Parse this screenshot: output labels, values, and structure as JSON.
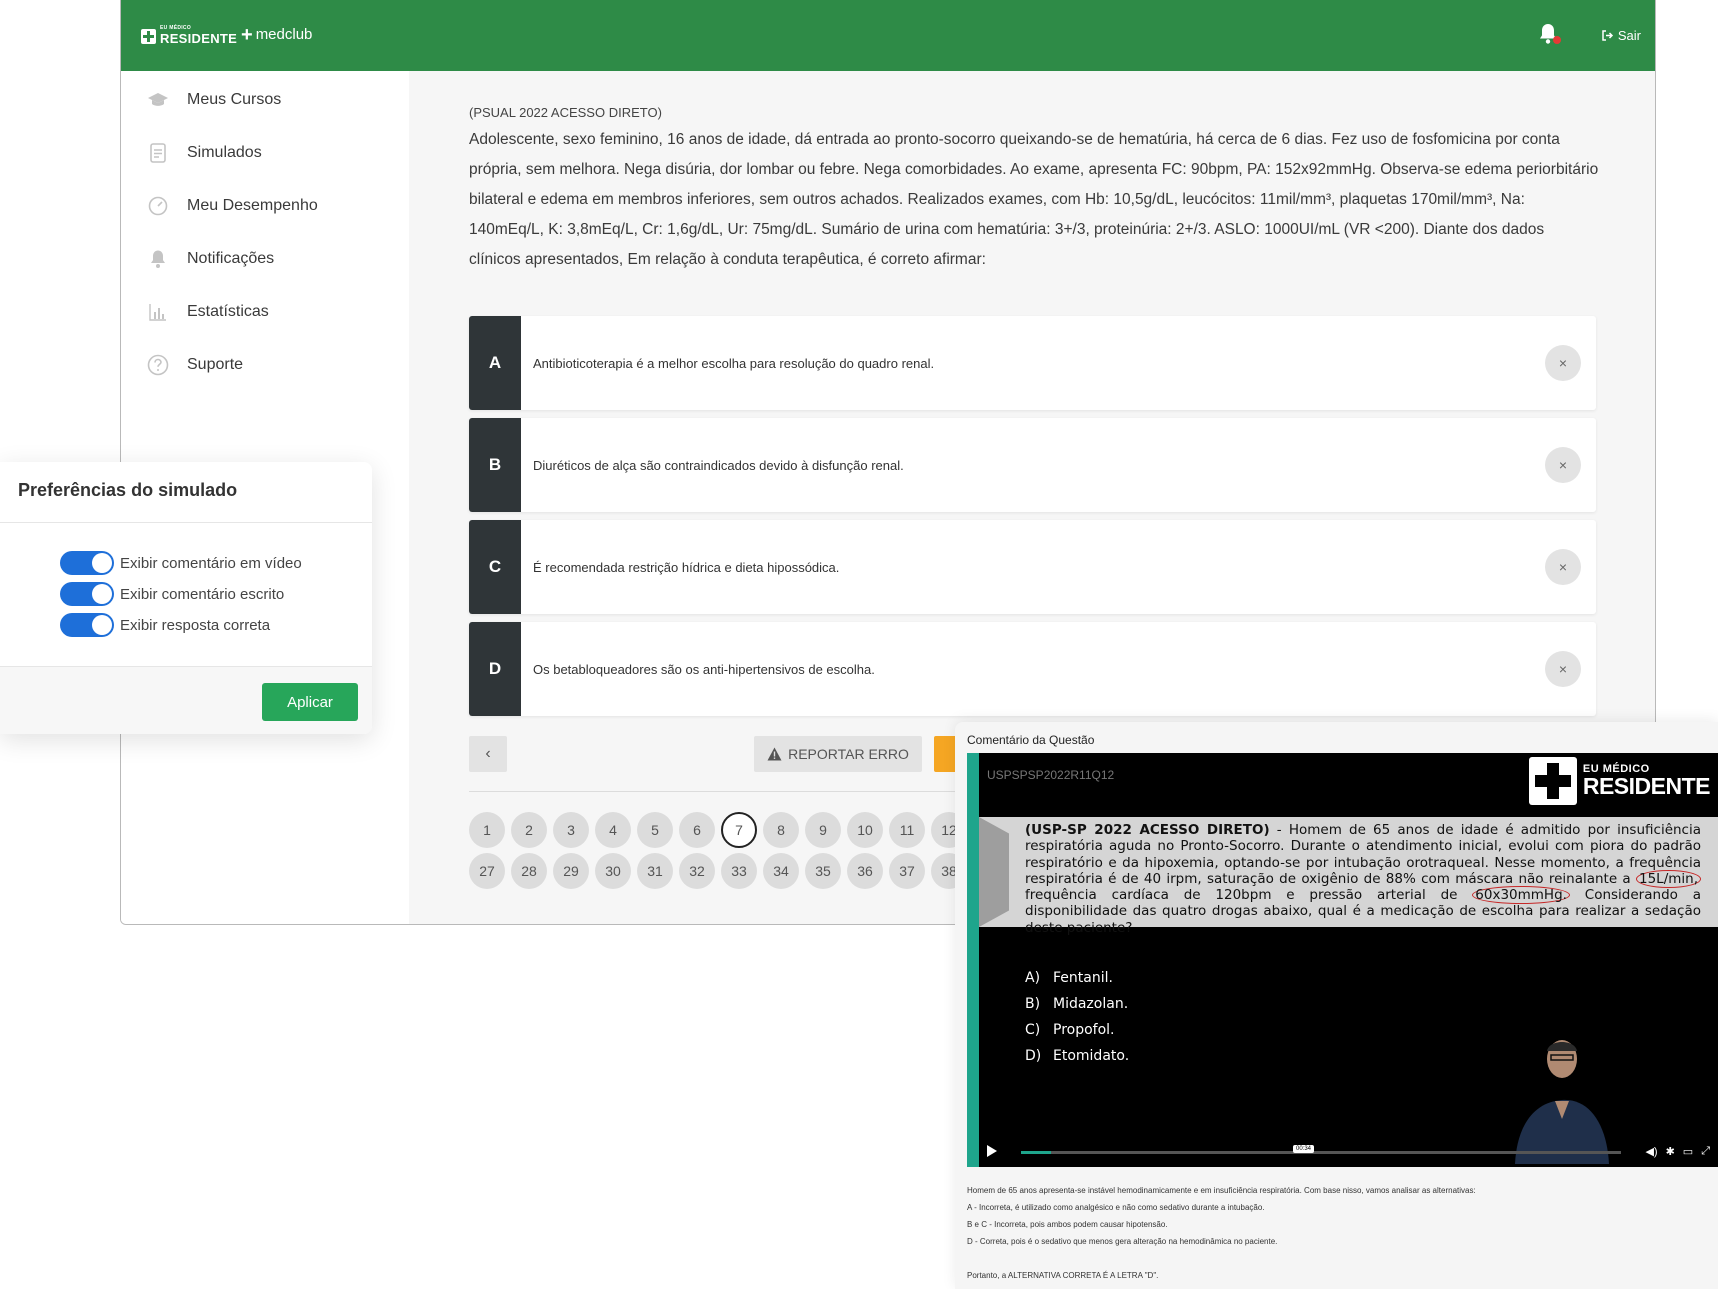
{
  "topbar": {
    "logo_small": "EU MÉDICO",
    "logo_main": "RESIDENTE",
    "logo_medclub": "medclub",
    "logout_label": "Sair"
  },
  "sidebar": {
    "items": [
      {
        "label": "Meus Cursos",
        "icon": "graduation-cap-icon"
      },
      {
        "label": "Simulados",
        "icon": "document-icon"
      },
      {
        "label": "Meu Desempenho",
        "icon": "gauge-icon"
      },
      {
        "label": "Notificações",
        "icon": "bell-icon"
      },
      {
        "label": "Estatísticas",
        "icon": "bar-chart-icon"
      },
      {
        "label": "Suporte",
        "icon": "help-icon"
      }
    ]
  },
  "question": {
    "source": "(PSUAL 2022 ACESSO DIRETO)",
    "text": "Adolescente, sexo feminino, 16 anos de idade, dá entrada ao pronto-socorro queixando-se de hematúria, há cerca de 6 dias. Fez uso de fosfomicina por conta própria, sem melhora. Nega disúria, dor lombar ou febre. Nega comorbidades. Ao exame, apresenta FC: 90bpm, PA: 152x92mmHg. Observa-se edema periorbitário bilateral e edema em membros inferiores, sem outros achados. Realizados exames, com Hb: 10,5g/dL, leucócitos: 11mil/mm³, plaquetas 170mil/mm³, Na: 140mEq/L, K: 3,8mEq/L, Cr: 1,6g/dL, Ur: 75mg/dL. Sumário de urina com hematúria: 3+/3, proteinúria: 2+/3. ASLO: 1000UI/mL (VR <200). Diante dos dados clínicos apresentados, Em relação à conduta terapêutica, é correto afirmar:",
    "alternatives": [
      {
        "letter": "A",
        "text": "Antibioticoterapia é a melhor escolha para resolução do quadro renal."
      },
      {
        "letter": "B",
        "text": "Diuréticos de alça são contraindicados devido à disfunção renal."
      },
      {
        "letter": "C",
        "text": "É recomendada restrição hídrica e dieta hipossódica."
      },
      {
        "letter": "D",
        "text": "Os betabloqueadores são os anti-hipertensivos de escolha."
      }
    ],
    "close_glyph": "×"
  },
  "actions": {
    "prev_glyph": "‹",
    "report_label": "REPORTAR ERRO"
  },
  "pager": {
    "row1": [
      "1",
      "2",
      "3",
      "4",
      "5",
      "6",
      "7",
      "8",
      "9",
      "10",
      "11",
      "12"
    ],
    "row2": [
      "27",
      "28",
      "29",
      "30",
      "31",
      "32",
      "33",
      "34",
      "35",
      "36",
      "37",
      "38"
    ],
    "active": "7"
  },
  "prefs": {
    "title": "Preferências do simulado",
    "options": [
      {
        "label": "Exibir comentário em vídeo",
        "on": true
      },
      {
        "label": "Exibir comentário escrito",
        "on": true
      },
      {
        "label": "Exibir resposta correta",
        "on": true
      }
    ],
    "apply_label": "Aplicar"
  },
  "comment": {
    "title": "Comentário da Questão",
    "video": {
      "code": "USPSPSP2022R11Q12",
      "brand_small": "EU MÉDICO",
      "brand_main": "RESIDENTE",
      "slide_header": "(USP-SP 2022 ACESSO DIRETO)",
      "slide_part1": " - Homem de 65 anos de idade é admitido por insuficiência respiratória aguda no Pronto-Socorro. Durante o atendimento inicial, evolui com piora do padrão respiratório e da hipoxemia, optando-se por intubação orotraqueal. Nesse momento, a frequência respiratória é de 40 irpm, saturação de oxigênio de 88% com máscara não reinalante a ",
      "slide_circ1": "15L/min,",
      "slide_part2": " frequência cardíaca de 120bpm e pressão arterial de ",
      "slide_circ2": "60x30mmHg.",
      "slide_part3": " Considerando a disponibilidade das quatro drogas abaixo, qual é a medicação de escolha para realizar a sedação deste paciente?",
      "options": [
        {
          "letter": "A)",
          "text": "Fentanil."
        },
        {
          "letter": "B)",
          "text": "Midazolan."
        },
        {
          "letter": "C)",
          "text": "Propofol."
        },
        {
          "letter": "D)",
          "text": "Etomidato."
        }
      ],
      "time": "00:34",
      "progress": 0.05
    },
    "text_lines": [
      "Homem de 65 anos apresenta-se instável hemodinamicamente e em insuficiência respiratória. Com base nisso, vamos analisar as alternativas:",
      "A - Incorreta, é utilizado como analgésico e não como sedativo durante a intubação.",
      "B e C - Incorreta, pois ambos podem causar hipotensão.",
      "D - Correta, pois é o sedativo que menos gera alteração na hemodinâmica no paciente.",
      "",
      "Portanto, a ALTERNATIVA CORRETA É A LETRA \"D\"."
    ]
  },
  "colors": {
    "brand_green": "#2e8b47",
    "toggle_blue": "#1e6fd9",
    "apply_green": "#27a65a",
    "video_teal": "#1ea58c"
  }
}
